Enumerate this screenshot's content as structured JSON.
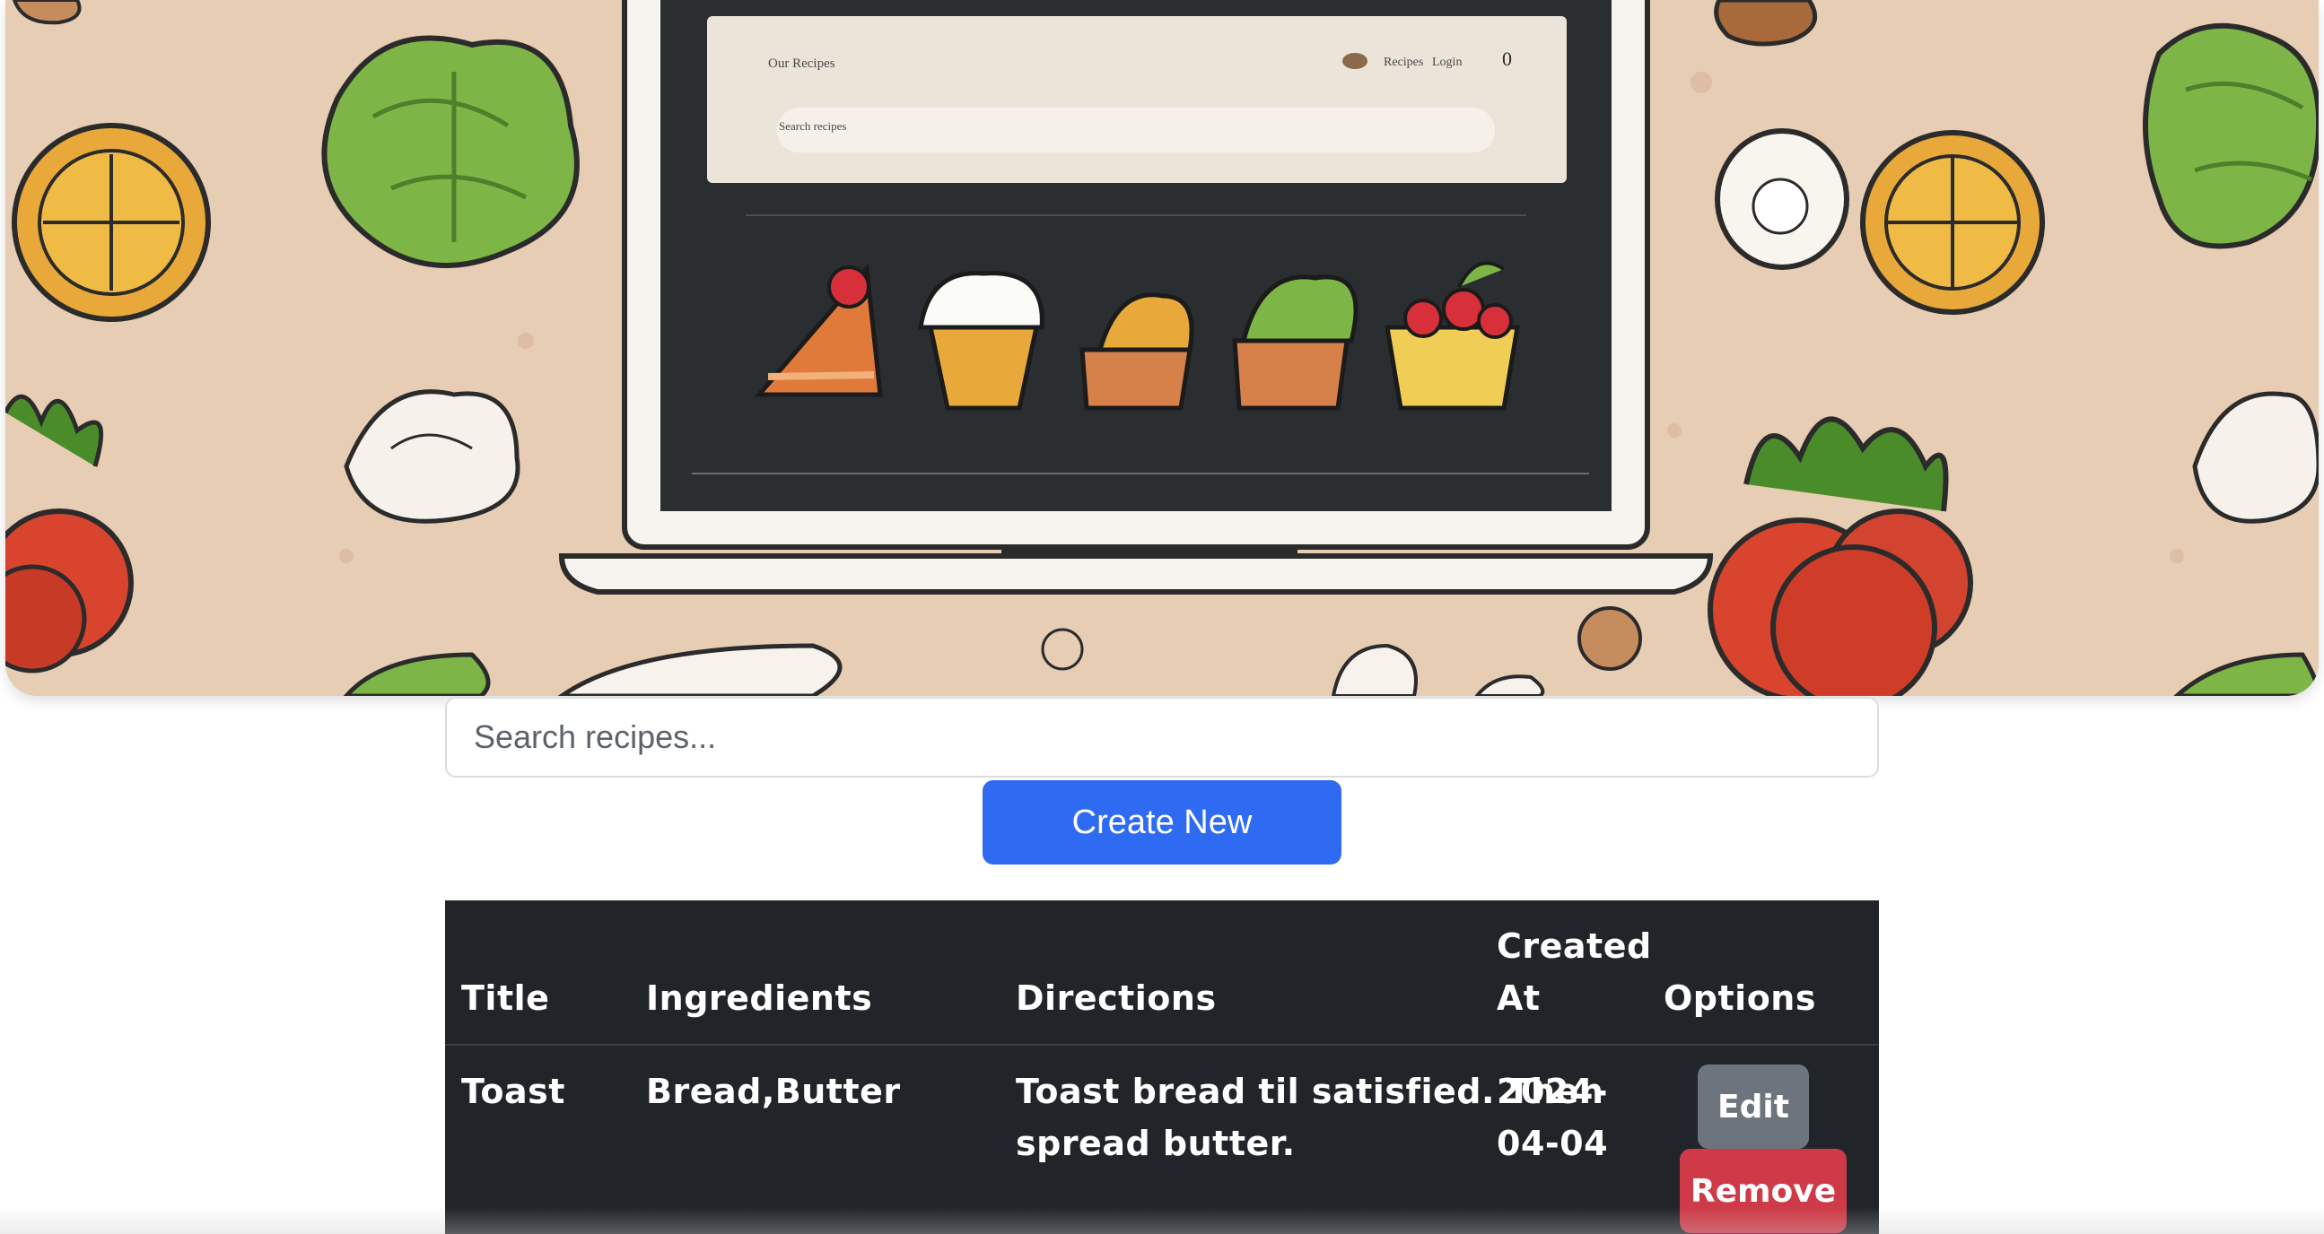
{
  "hero": {
    "screen_title": "Our Recipes",
    "screen_links": [
      "Recipes",
      "Login"
    ],
    "screen_badge": "0",
    "screen_search_text": "Search recipes"
  },
  "search": {
    "placeholder": "Search recipes..."
  },
  "actions": {
    "create_label": "Create New"
  },
  "table": {
    "headers": {
      "title": "Title",
      "ingredients": "Ingredients",
      "directions": "Directions",
      "created_line1": "Created",
      "created_line2": "At",
      "options": "Options"
    },
    "rows": [
      {
        "title": "Toast",
        "ingredients": "Bread,Butter",
        "directions_line1": "Toast bread til satisfied. Then",
        "directions_line2": "spread butter.",
        "created_line1": "2024-",
        "created_line2": "04-04",
        "edit_label": "Edit",
        "remove_label": "Remove"
      }
    ]
  },
  "colors": {
    "primary": "#2f6bf2",
    "secondary": "#6c757d",
    "danger": "#cf3a48",
    "table_dark": "#212529",
    "hero_background": "#e6cdb3"
  }
}
